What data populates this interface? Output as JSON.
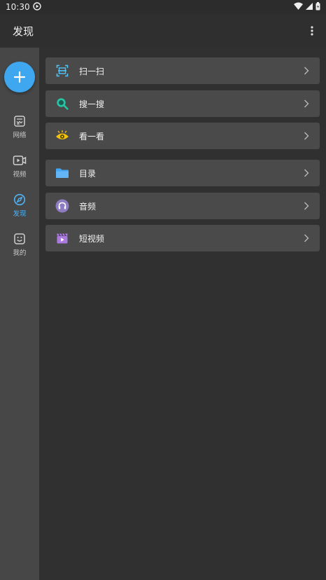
{
  "status": {
    "time": "10:30"
  },
  "appbar": {
    "title": "发现"
  },
  "sidebar": {
    "items": [
      {
        "label": "网络",
        "icon": "network-icon",
        "active": false
      },
      {
        "label": "视频",
        "icon": "video-icon",
        "active": false
      },
      {
        "label": "发现",
        "icon": "compass-icon",
        "active": true
      },
      {
        "label": "我的",
        "icon": "smiley-icon",
        "active": false
      }
    ]
  },
  "main": {
    "group1": [
      {
        "label": "扫一扫",
        "icon": "scan-icon"
      },
      {
        "label": "搜一搜",
        "icon": "search-icon"
      },
      {
        "label": "看一看",
        "icon": "eye-icon"
      }
    ],
    "group2": [
      {
        "label": "目录",
        "icon": "folder-icon"
      },
      {
        "label": "音频",
        "icon": "headphones-icon"
      },
      {
        "label": "短视频",
        "icon": "clapper-icon"
      }
    ]
  },
  "colors": {
    "accent": "#3fa7f0",
    "background": "#303030",
    "sidebar": "#474747",
    "row": "#4a4a4a"
  }
}
